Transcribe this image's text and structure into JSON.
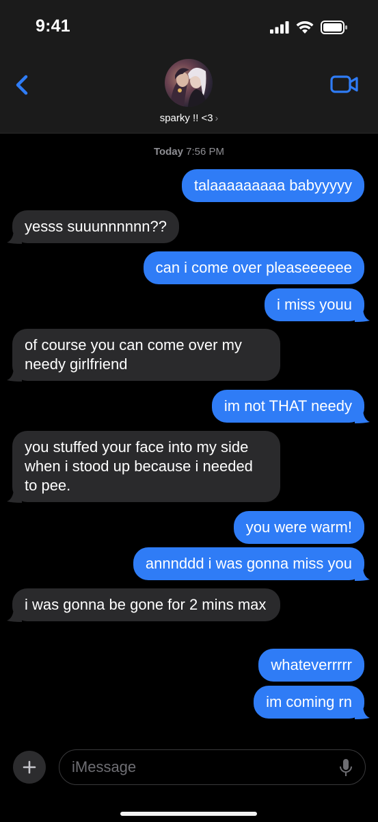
{
  "status_bar": {
    "time": "9:41"
  },
  "header": {
    "contact_name": "sparky !! <3",
    "chevron": "›"
  },
  "conversation": {
    "timestamp_day": "Today",
    "timestamp_time": "7:56 PM",
    "messages": [
      {
        "sender": "me",
        "text": "talaaaaaaaaa babyyyyy"
      },
      {
        "sender": "them",
        "text": "yesss suuunnnnnn??"
      },
      {
        "sender": "me",
        "text": "can i come over pleaseeeeee"
      },
      {
        "sender": "me",
        "text": "i miss youu"
      },
      {
        "sender": "them",
        "text": "of course you can come over my needy girlfriend"
      },
      {
        "sender": "me",
        "text": "im not THAT needy"
      },
      {
        "sender": "them",
        "text": "you stuffed your face into my side when i stood up because i needed to pee."
      },
      {
        "sender": "me",
        "text": "you were warm!"
      },
      {
        "sender": "me",
        "text": "annnddd i was gonna miss you"
      },
      {
        "sender": "them",
        "text": "i was gonna be gone for 2 mins max"
      },
      {
        "sender": "me",
        "text": "whateverrrrr"
      },
      {
        "sender": "me",
        "text": "im coming rn"
      }
    ]
  },
  "composer": {
    "placeholder": "iMessage"
  },
  "colors": {
    "sent_bubble": "#2f7cf6",
    "received_bubble": "#2a2a2c",
    "accent": "#2f7cf6"
  },
  "icons": [
    "signal-icon",
    "wifi-icon",
    "battery-icon",
    "back-chevron-icon",
    "facetime-video-icon",
    "plus-icon",
    "microphone-icon"
  ]
}
